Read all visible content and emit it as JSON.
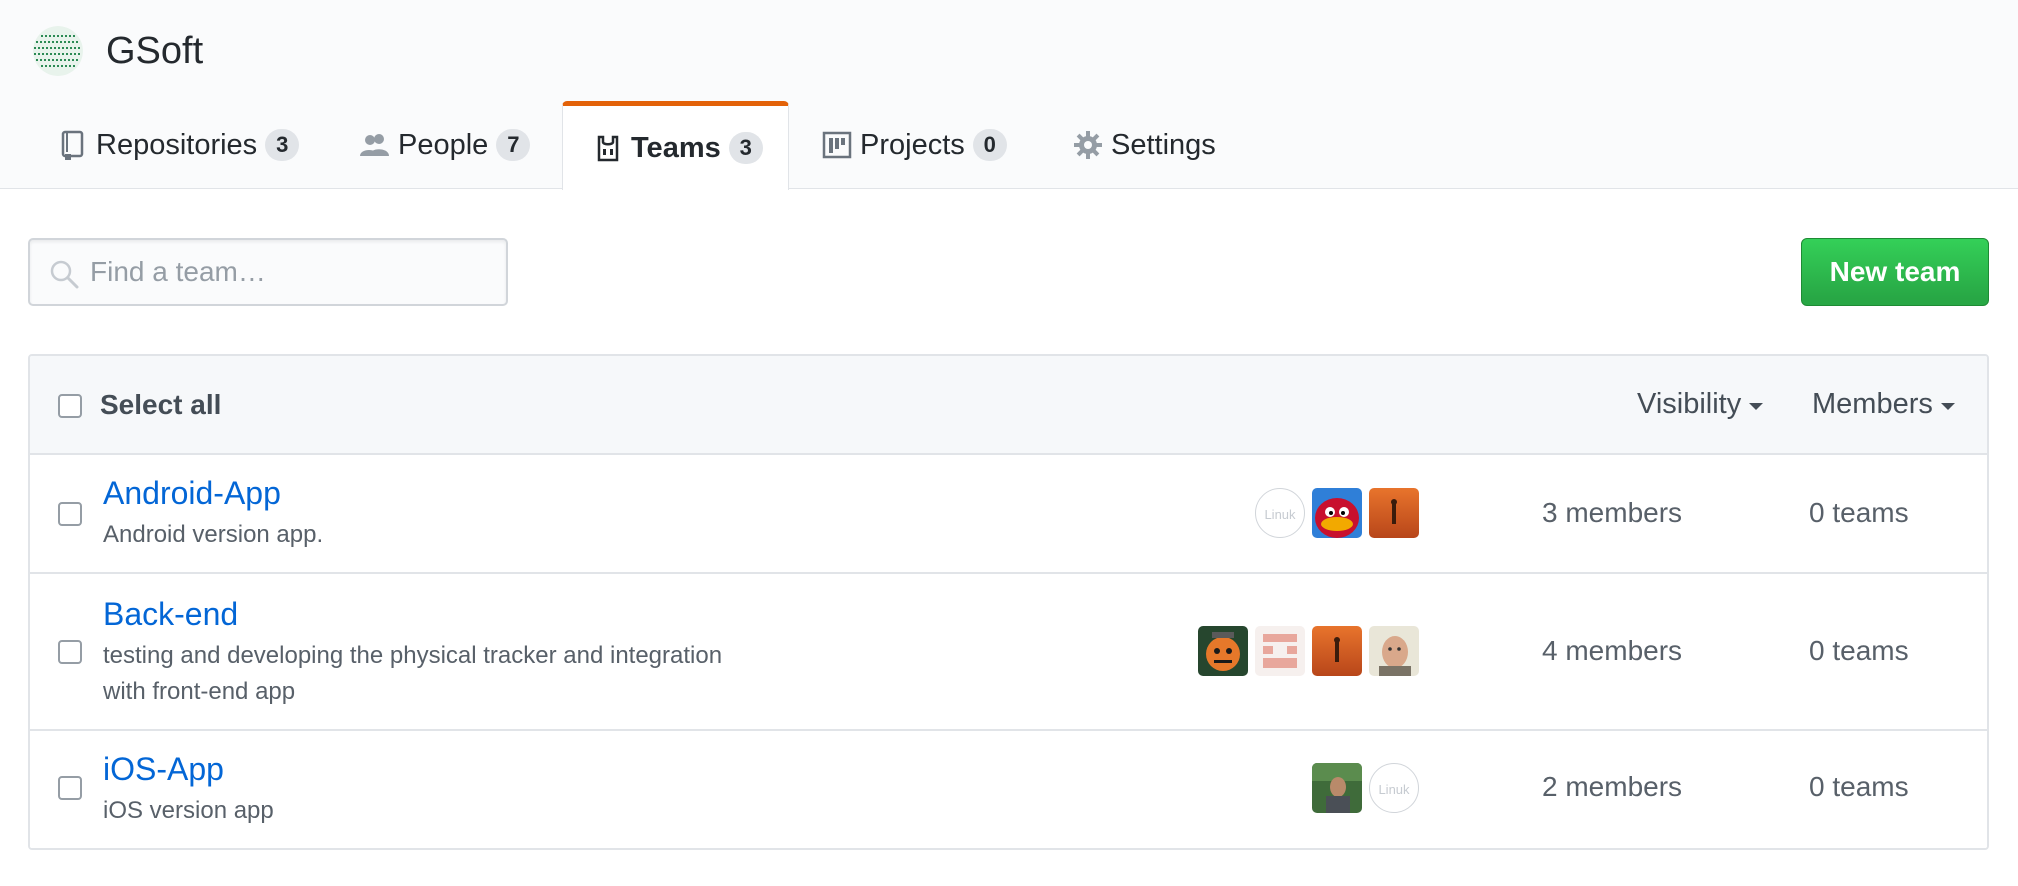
{
  "org": {
    "name": "GSoft"
  },
  "tabs": [
    {
      "label": "Repositories",
      "count": "3",
      "icon": "repo-icon"
    },
    {
      "label": "People",
      "count": "7",
      "icon": "people-icon"
    },
    {
      "label": "Teams",
      "count": "3",
      "icon": "teams-icon",
      "selected": true
    },
    {
      "label": "Projects",
      "count": "0",
      "icon": "project-icon"
    },
    {
      "label": "Settings",
      "icon": "gear-icon"
    }
  ],
  "search": {
    "placeholder": "Find a team…"
  },
  "toolbar": {
    "new_team_label": "New team"
  },
  "table": {
    "select_all_label": "Select all",
    "visibility_label": "Visibility",
    "members_label": "Members",
    "rows": [
      {
        "name": "Android-App",
        "desc": "Android version app.",
        "members": "3 members",
        "teams": "0 teams"
      },
      {
        "name": "Back-end",
        "desc": "testing and developing the physical tracker and integration with front-end app",
        "members": "4 members",
        "teams": "0 teams"
      },
      {
        "name": "iOS-App",
        "desc": "iOS version app",
        "members": "2 members",
        "teams": "0 teams"
      }
    ]
  },
  "avatar_text": "Linuk",
  "colors": {
    "accent_tab": "#e36209",
    "link": "#0366d6",
    "button_green": "#28a745"
  }
}
